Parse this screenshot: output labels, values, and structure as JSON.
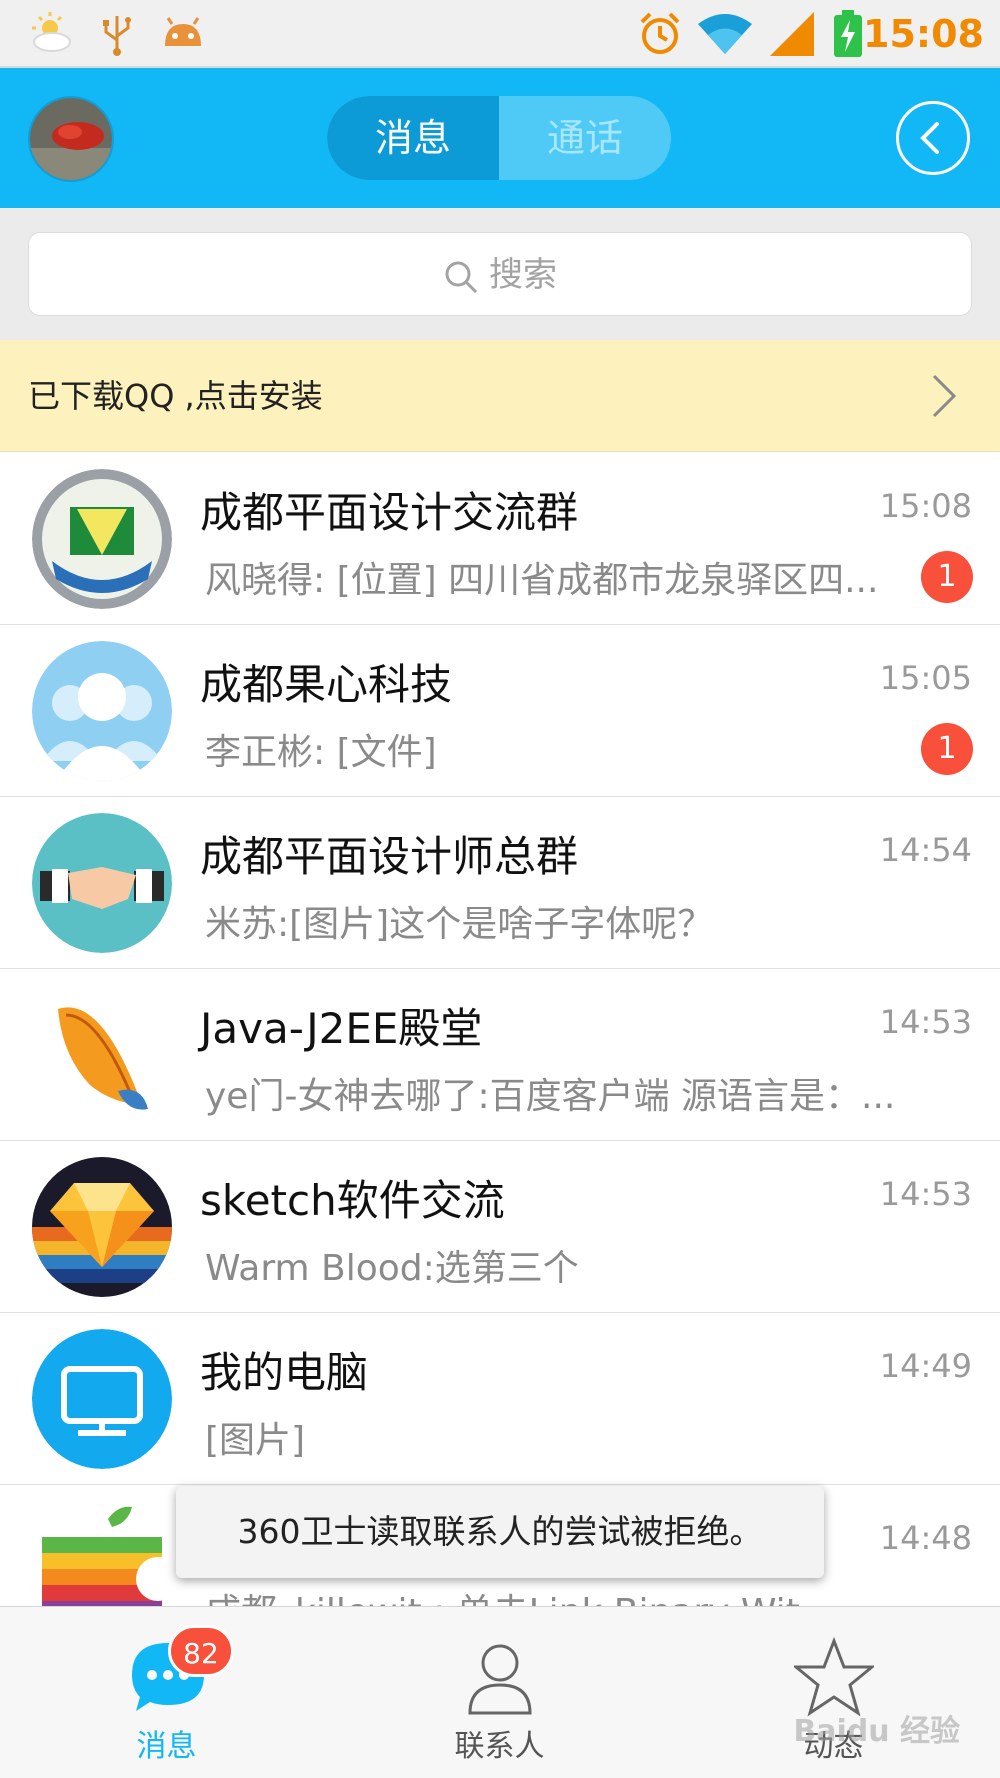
{
  "status_bar": {
    "time": "15:08",
    "icons": [
      "weather-icon",
      "usb-icon",
      "android-debug-icon",
      "alarm-icon",
      "wifi-icon",
      "signal-icon",
      "battery-charging-icon"
    ]
  },
  "header": {
    "tabs": [
      {
        "label": "消息",
        "active": true
      },
      {
        "label": "通话",
        "active": false
      }
    ],
    "back_icon": "chevron-left-icon"
  },
  "search": {
    "placeholder": "搜索"
  },
  "banner": {
    "text": "已下载QQ ,点击安装"
  },
  "conversations": [
    {
      "name": "成都平面设计交流群",
      "time": "15:08",
      "message": "风晓得: [位置] 四川省成都市龙泉驿区四...",
      "unread": "1"
    },
    {
      "name": "成都果心科技",
      "time": "15:05",
      "message": "李正彬: [文件]",
      "unread": "1"
    },
    {
      "name": "成都平面设计师总群",
      "time": "14:54",
      "message": "米苏:[图片]这个是啥子字体呢？",
      "unread": ""
    },
    {
      "name": "Java-J2EE殿堂",
      "time": "14:53",
      "message": "ye门-女神去哪了:百度客户端   源语言是：...",
      "unread": ""
    },
    {
      "name": "sketch软件交流",
      "time": "14:53",
      "message": "Warm Blood:选第三个",
      "unread": ""
    },
    {
      "name": "我的电脑",
      "time": "14:49",
      "message": "[图片]",
      "unread": ""
    },
    {
      "name": "",
      "time": "14:48",
      "message": "成都_killewit :          单击Link Binary Wit",
      "unread": ""
    }
  ],
  "toast": {
    "text": "360卫士读取联系人的尝试被拒绝。"
  },
  "bottom_nav": {
    "items": [
      {
        "label": "消息",
        "badge": "82",
        "active": true
      },
      {
        "label": "联系人",
        "active": false
      },
      {
        "label": "动态",
        "active": false
      }
    ]
  },
  "watermark": "Baidu 经验",
  "colors": {
    "brand": "#12b7f5",
    "badge": "#f8503a",
    "time_accent": "#f08a00",
    "banner_bg": "#fdf1bd"
  }
}
